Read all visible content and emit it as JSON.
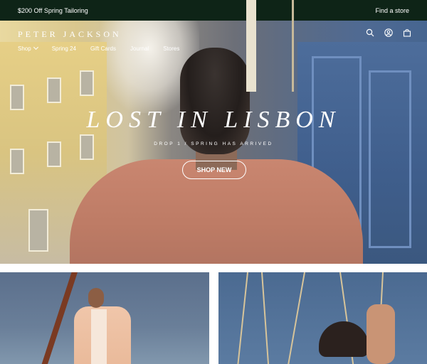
{
  "announcement": {
    "promo": "$200 Off Spring Tailoring",
    "find_store": "Find a store"
  },
  "header": {
    "logo": "PETER JACKSON",
    "nav": [
      "Shop",
      "Spring 24",
      "Gift Cards",
      "Journal",
      "Stores"
    ],
    "icons": [
      "search-icon",
      "account-icon",
      "bag-icon"
    ]
  },
  "hero": {
    "title": "LOST IN LISBON",
    "subtitle": "DROP 1 / SPRING HAS ARRIVED",
    "cta": "SHOP NEW"
  },
  "colors": {
    "announcement_bg": "#0e2417",
    "text_on_dark": "#ffffff"
  }
}
